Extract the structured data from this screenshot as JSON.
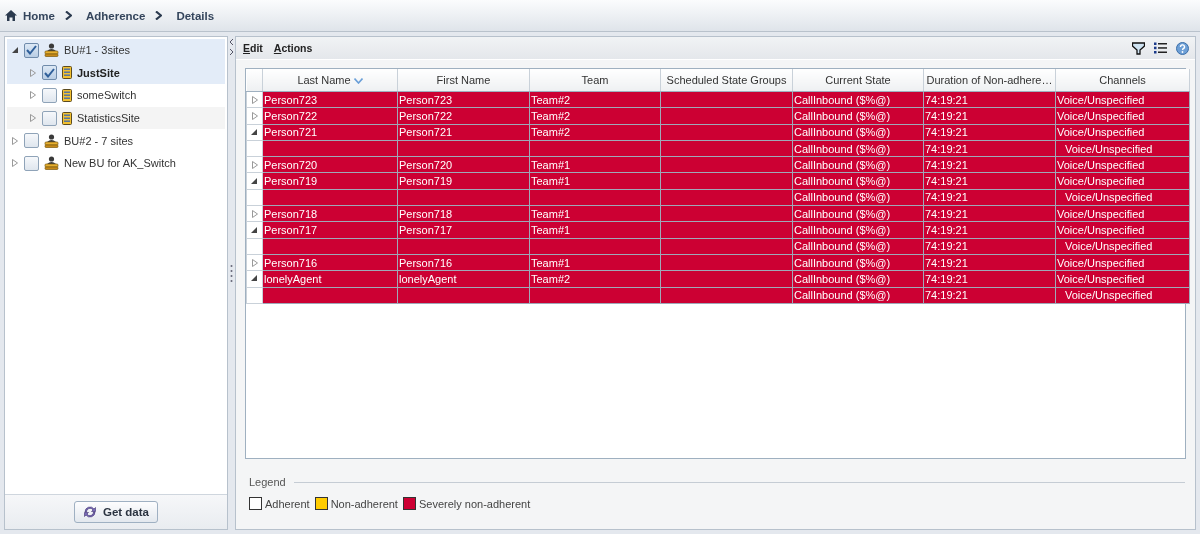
{
  "breadcrumb": [
    {
      "label": "Home"
    },
    {
      "label": "Adherence"
    },
    {
      "label": "Details"
    }
  ],
  "tree": [
    {
      "label": "BU#1 - 3sites",
      "kind": "business-unit",
      "checked": true,
      "expanded": true,
      "selected": true,
      "focused": false,
      "children": [
        {
          "label": "JustSite",
          "kind": "site",
          "checked": true,
          "expanded": false,
          "selected": true,
          "focused": true
        },
        {
          "label": "someSwitch",
          "kind": "site",
          "checked": false,
          "expanded": false,
          "selected": false,
          "focused": false
        },
        {
          "label": "StatisticsSite",
          "kind": "site",
          "checked": false,
          "expanded": false,
          "selected": false,
          "focused": false
        }
      ]
    },
    {
      "label": "BU#2 - 7 sites",
      "kind": "business-unit",
      "checked": false,
      "expanded": false,
      "selected": false,
      "focused": false
    },
    {
      "label": "New BU for AK_Switch",
      "kind": "business-unit",
      "checked": false,
      "expanded": false,
      "selected": false,
      "focused": false
    }
  ],
  "get_data_button": "Get data",
  "menu": [
    "Edit",
    "Actions"
  ],
  "grid": {
    "columns": [
      {
        "label": "Last Name",
        "sorted": true
      },
      {
        "label": "First Name",
        "sorted": false
      },
      {
        "label": "Team",
        "sorted": false
      },
      {
        "label": "Scheduled State Groups",
        "sorted": false
      },
      {
        "label": "Current State",
        "sorted": false
      },
      {
        "label": "Duration of Non-adhere…",
        "sorted": false
      },
      {
        "label": "Channels",
        "sorted": false
      }
    ],
    "rows": [
      {
        "kind": "agent",
        "expanded": false,
        "color": "#cc0033",
        "last_name": "Person723",
        "first_name": "Person723",
        "team": "Team#2",
        "current_state": "CallInbound ($%@)",
        "duration": "74:19:21",
        "channels": "Voice/Unspecified"
      },
      {
        "kind": "agent",
        "expanded": false,
        "color": "#cc0033",
        "last_name": "Person722",
        "first_name": "Person722",
        "team": "Team#2",
        "current_state": "CallInbound ($%@)",
        "duration": "74:19:21",
        "channels": "Voice/Unspecified"
      },
      {
        "kind": "agent",
        "expanded": true,
        "color": "#cc0033",
        "last_name": "Person721",
        "first_name": "Person721",
        "team": "Team#2",
        "current_state": "CallInbound ($%@)",
        "duration": "74:19:21",
        "channels": "Voice/Unspecified"
      },
      {
        "kind": "state",
        "color": "#cc0033",
        "current_state": "CallInbound ($%@)",
        "duration": "74:19:21",
        "channels": "Voice/Unspecified"
      },
      {
        "kind": "agent",
        "expanded": false,
        "color": "#cc0033",
        "last_name": "Person720",
        "first_name": "Person720",
        "team": "Team#1",
        "current_state": "CallInbound ($%@)",
        "duration": "74:19:21",
        "channels": "Voice/Unspecified"
      },
      {
        "kind": "agent",
        "expanded": true,
        "color": "#cc0033",
        "last_name": "Person719",
        "first_name": "Person719",
        "team": "Team#1",
        "current_state": "CallInbound ($%@)",
        "duration": "74:19:21",
        "channels": "Voice/Unspecified"
      },
      {
        "kind": "state",
        "color": "#cc0033",
        "current_state": "CallInbound ($%@)",
        "duration": "74:19:21",
        "channels": "Voice/Unspecified"
      },
      {
        "kind": "agent",
        "expanded": false,
        "color": "#cc0033",
        "last_name": "Person718",
        "first_name": "Person718",
        "team": "Team#1",
        "current_state": "CallInbound ($%@)",
        "duration": "74:19:21",
        "channels": "Voice/Unspecified"
      },
      {
        "kind": "agent",
        "expanded": true,
        "color": "#cc0033",
        "last_name": "Person717",
        "first_name": "Person717",
        "team": "Team#1",
        "current_state": "CallInbound ($%@)",
        "duration": "74:19:21",
        "channels": "Voice/Unspecified"
      },
      {
        "kind": "state",
        "color": "#cc0033",
        "current_state": "CallInbound ($%@)",
        "duration": "74:19:21",
        "channels": "Voice/Unspecified"
      },
      {
        "kind": "agent",
        "expanded": false,
        "color": "#cc0033",
        "last_name": "Person716",
        "first_name": "Person716",
        "team": "Team#1",
        "current_state": "CallInbound ($%@)",
        "duration": "74:19:21",
        "channels": "Voice/Unspecified"
      },
      {
        "kind": "agent",
        "expanded": true,
        "color": "#cc0033",
        "last_name": "lonelyAgent",
        "first_name": "lonelyAgent",
        "team": "Team#2",
        "current_state": "CallInbound ($%@)",
        "duration": "74:19:21",
        "channels": "Voice/Unspecified"
      },
      {
        "kind": "state",
        "color": "#cc0033",
        "current_state": "CallInbound ($%@)",
        "duration": "74:19:21",
        "channels": "Voice/Unspecified"
      }
    ]
  },
  "legend": {
    "title": "Legend",
    "items": [
      {
        "label": "Adherent",
        "color": "#ffffff"
      },
      {
        "label": "Non-adherent",
        "color": "#ffcc00"
      },
      {
        "label": "Severely non-adherent",
        "color": "#cc0033"
      }
    ]
  }
}
